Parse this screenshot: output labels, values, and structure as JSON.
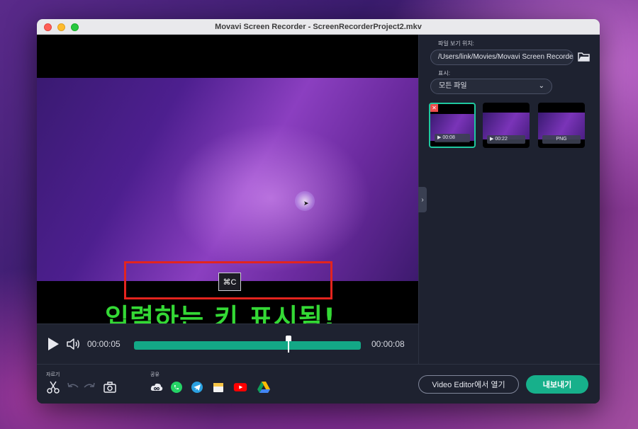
{
  "window": {
    "title": "Movavi Screen Recorder - ScreenRecorderProject2.mkv"
  },
  "preview": {
    "key_shortcut": "⌘C",
    "caption": "입력하는 키 표시됨!"
  },
  "playback": {
    "current_time": "00:00:05",
    "total_time": "00:00:08",
    "progress": 0.68
  },
  "sidebar": {
    "location_label": "파일 보기 위치:",
    "location_path": "/Users/link/Movies/Movavi Screen Recorder",
    "display_label": "표시:",
    "display_value": "모든 파일",
    "thumbnails": [
      {
        "label": "00:08",
        "type": "video",
        "selected": true
      },
      {
        "label": "00:22",
        "type": "video",
        "selected": false
      },
      {
        "label": "PNG",
        "type": "image",
        "selected": false
      }
    ]
  },
  "toolbar": {
    "cut_label": "자르기",
    "share_label": "공유",
    "open_editor_label": "Video Editor에서 열기",
    "export_label": "내보내기"
  },
  "colors": {
    "accent": "#17b08b",
    "highlight_box": "#e3241e",
    "caption_text": "#34d935",
    "window_bg": "#1e2230"
  },
  "icons": {
    "cut": "scissors-icon",
    "undo": "undo-icon",
    "redo": "redo-icon",
    "snapshot": "camera-icon",
    "share_link": "cloud-link-icon",
    "share_whatsapp": "whatsapp-icon",
    "share_telegram": "telegram-icon",
    "share_drive_folder": "folder-share-icon",
    "share_youtube": "youtube-icon",
    "share_gdrive": "google-drive-icon"
  }
}
